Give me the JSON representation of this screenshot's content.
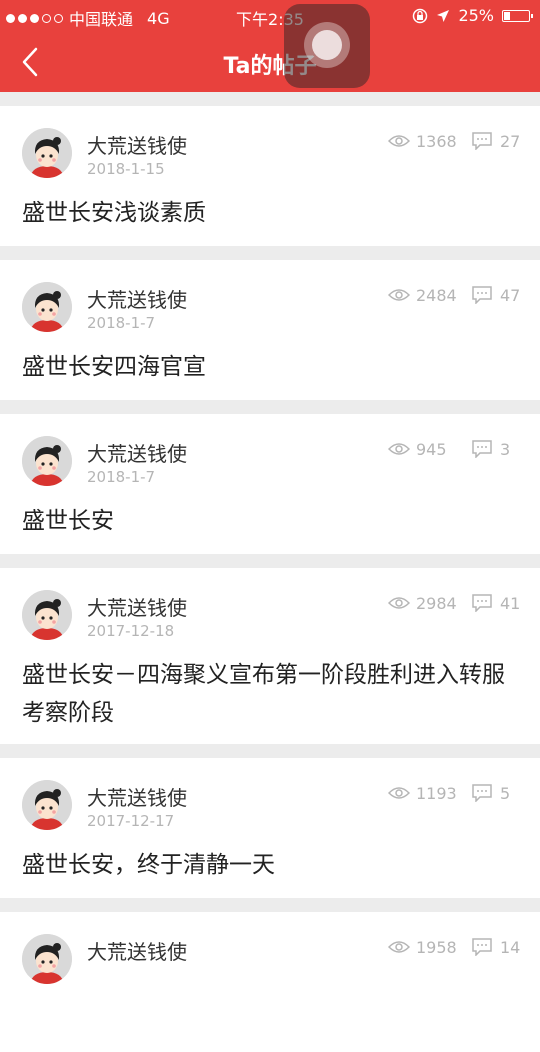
{
  "status_bar": {
    "carrier": "中国联通",
    "network": "4G",
    "time": "下午2:35",
    "battery": "25%"
  },
  "nav": {
    "title": "Ta的帖子"
  },
  "posts": [
    {
      "author": "大荒送钱使",
      "date": "2018-1-15",
      "views": "1368",
      "comments": "27",
      "title": "盛世长安浅谈素质"
    },
    {
      "author": "大荒送钱使",
      "date": "2018-1-7",
      "views": "2484",
      "comments": "47",
      "title": "盛世长安四海官宣"
    },
    {
      "author": "大荒送钱使",
      "date": "2018-1-7",
      "views": "945",
      "comments": "3",
      "title": "盛世长安"
    },
    {
      "author": "大荒送钱使",
      "date": "2017-12-18",
      "views": "2984",
      "comments": "41",
      "title": "盛世长安－四海聚义宣布第一阶段胜利进入转服考察阶段"
    },
    {
      "author": "大荒送钱使",
      "date": "2017-12-17",
      "views": "1193",
      "comments": "5",
      "title": "盛世长安，终于清静一天"
    },
    {
      "author": "大荒送钱使",
      "date": "",
      "views": "1958",
      "comments": "14",
      "title": ""
    }
  ],
  "colors": {
    "accent": "#e8413d",
    "muted": "#b5b5b5"
  }
}
